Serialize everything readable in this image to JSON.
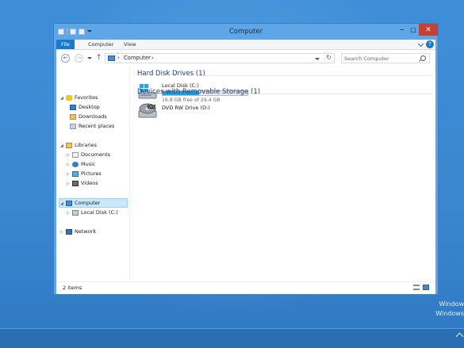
{
  "window": {
    "title": "Computer",
    "buttons": {
      "minimize": "−",
      "maximize": "□",
      "close": "✕"
    }
  },
  "ribbon": {
    "tabs": [
      "File",
      "Computer",
      "View"
    ],
    "help": "?"
  },
  "address_bar": {
    "sep1": "›",
    "path": "Computer",
    "sep2": "›"
  },
  "search": {
    "placeholder": "Search Computer"
  },
  "nav_pane": {
    "favorites": {
      "label": "Favorites",
      "items": [
        "Desktop",
        "Downloads",
        "Recent places"
      ]
    },
    "libraries": {
      "label": "Libraries",
      "items": [
        "Documents",
        "Music",
        "Pictures",
        "Videos"
      ]
    },
    "computer": {
      "label": "Computer",
      "items": [
        "Local Disk (C:)"
      ]
    },
    "network": {
      "label": "Network"
    }
  },
  "content": {
    "hard_disks": {
      "heading": "Hard Disk Drives (1)",
      "drives": [
        {
          "name": "Local Disk (C:)",
          "free": "16.8 GB free of 29.4 GB",
          "used_fraction": 0.43
        }
      ]
    },
    "removable": {
      "heading": "Devices with Removable Storage (1)",
      "drives": [
        {
          "name": "DVD RW Drive (D:)",
          "disc_label": "DVD"
        }
      ]
    }
  },
  "status": {
    "items": "2 items"
  },
  "desktop": {
    "watermark_line1": "Window",
    "watermark_line2": "Windows"
  },
  "colors": {
    "accent": "#1979ca",
    "close": "#c84031",
    "selection": "#cce8ff",
    "heading": "#1e3c8c",
    "bar_fill": "#26a0da"
  },
  "icons": [
    "back-arrow-icon",
    "forward-arrow-icon",
    "up-arrow-icon",
    "refresh-icon",
    "search-icon",
    "star-icon",
    "folder-icon",
    "computer-icon",
    "hard-drive-icon",
    "dvd-drive-icon",
    "network-icon"
  ]
}
